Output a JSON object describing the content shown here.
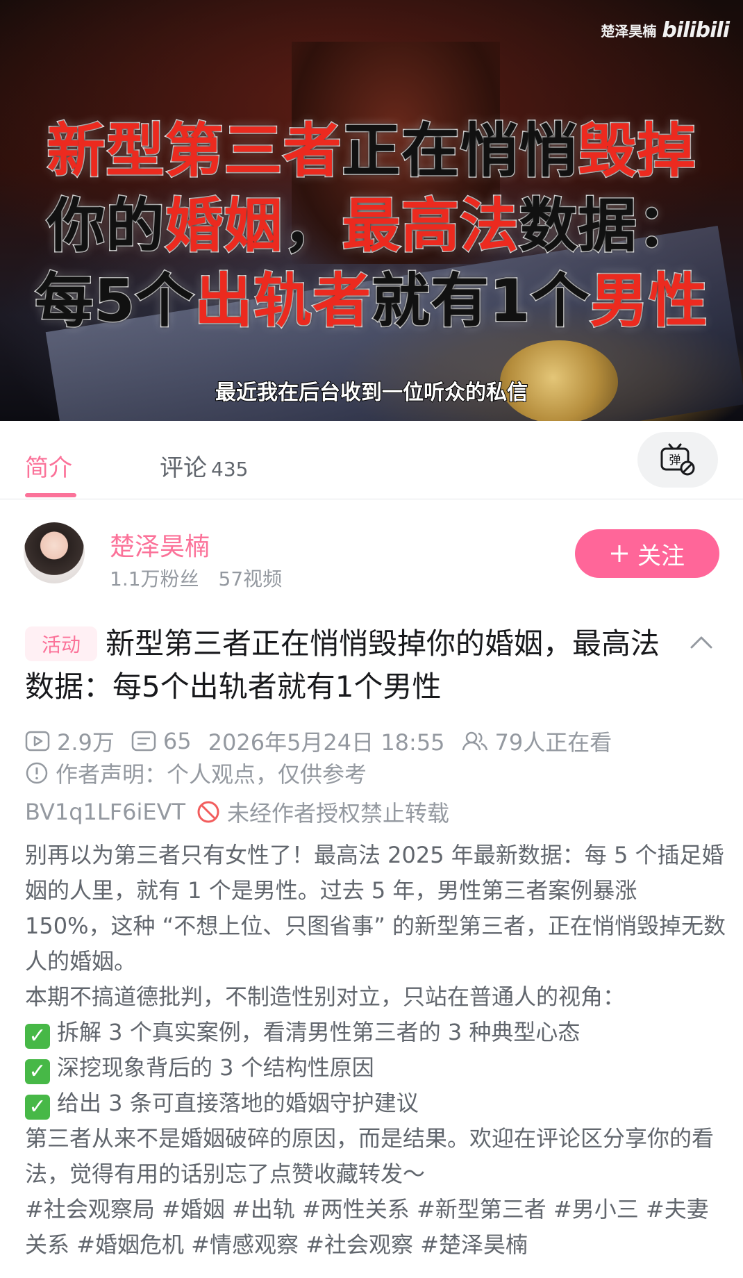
{
  "video": {
    "watermark_author": "楚泽昊楠",
    "watermark_brand": "bilibili",
    "cover_line1": [
      {
        "text": "新型第三者",
        "color": "red"
      },
      {
        "text": "正在悄悄",
        "color": "black"
      },
      {
        "text": "毁掉",
        "color": "red"
      }
    ],
    "cover_line2": [
      {
        "text": "你的",
        "color": "black"
      },
      {
        "text": "婚姻",
        "color": "red"
      },
      {
        "text": "，",
        "color": "black"
      },
      {
        "text": "最高法",
        "color": "red"
      },
      {
        "text": "数据：",
        "color": "black"
      }
    ],
    "cover_line3": [
      {
        "text": "每5个",
        "color": "black"
      },
      {
        "text": "出轨者",
        "color": "red"
      },
      {
        "text": "就有1个",
        "color": "black"
      },
      {
        "text": "男性",
        "color": "red"
      }
    ],
    "subtitle": "最近我在后台收到一位听众的私信"
  },
  "tabs": {
    "intro": "简介",
    "comments": "评论",
    "comments_count": "435",
    "danmaku_icon": "danmaku-toggle-icon"
  },
  "uploader": {
    "name": "楚泽昊楠",
    "fans": "1.1万粉丝",
    "videos": "57视频",
    "follow_label": "关注"
  },
  "title": {
    "tag": "活动",
    "text": "新型第三者正在悄悄毁掉你的婚姻，最高法数据：每5个出轨者就有1个男性"
  },
  "meta": {
    "views": "2.9万",
    "danmaku": "65",
    "date": "2026年5月24日 18:55",
    "watching": "79人正在看",
    "statement": "作者声明：个人观点，仅供参考",
    "bvid": "BV1q1LF6iEVT",
    "copyright": "未经作者授权禁止转载"
  },
  "description": {
    "para1": "别再以为第三者只有女性了！最高法 2025 年最新数据：每 5 个插足婚姻的人里，就有 1 个是男性。过去 5 年，男性第三者案例暴涨 150%，这种 “不想上位、只图省事” 的新型第三者，正在悄悄毁掉无数人的婚姻。",
    "para2": "本期不搞道德批判，不制造性别对立，只站在普通人的视角：",
    "bullets": [
      "拆解 3 个真实案例，看清男性第三者的 3 种典型心态",
      "深挖现象背后的 3 个结构性原因",
      "给出 3 条可直接落地的婚姻守护建议"
    ],
    "para3": "第三者从来不是婚姻破碎的原因，而是结果。欢迎在评论区分享你的看法，觉得有用的话别忘了点赞收藏转发～",
    "hashtags": "#社会观察局 #婚姻 #出轨 #两性关系 #新型第三者 #男小三 #夫妻关系 #婚姻危机 #情感观察 #社会观察 #楚泽昊楠"
  },
  "colors": {
    "accent": "#fb7299",
    "follow_bg": "#ff6699",
    "cover_red": "#ec2a1f"
  }
}
